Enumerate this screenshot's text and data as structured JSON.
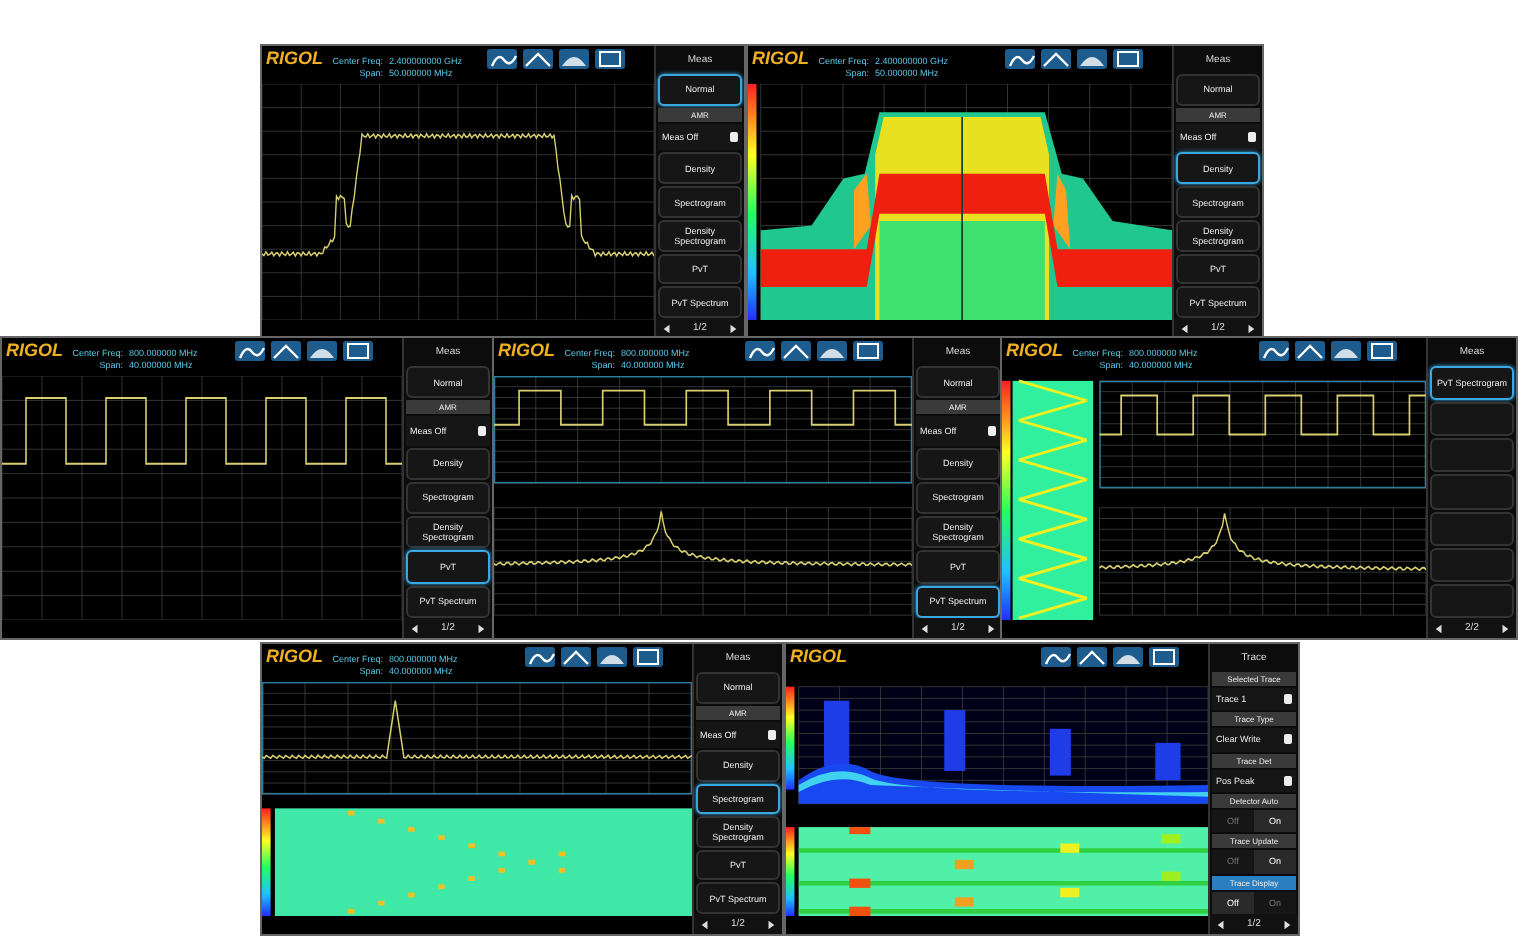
{
  "panels": [
    {
      "logo": "RIGOL",
      "readouts": [
        {
          "label": "Center Freq:",
          "value": "2.400000000 GHz"
        },
        {
          "label": "Span:",
          "value": "50.000000 MHz"
        }
      ],
      "plot": {
        "kind": "band"
      },
      "menu": {
        "title": "Meas",
        "page": "1/2",
        "items": [
          {
            "kind": "button",
            "label": "Normal",
            "selected": true
          },
          {
            "kind": "header",
            "label": "AMR"
          },
          {
            "kind": "select",
            "label": "Meas Off"
          },
          {
            "kind": "button",
            "label": "Density",
            "selected": false
          },
          {
            "kind": "button",
            "label": "Spectrogram",
            "selected": false
          },
          {
            "kind": "button",
            "label": "Density Spectrogram",
            "selected": false
          },
          {
            "kind": "button",
            "label": "PvT",
            "selected": false
          },
          {
            "kind": "button",
            "label": "PvT Spectrum",
            "selected": false
          }
        ]
      }
    },
    {
      "logo": "RIGOL",
      "readouts": [
        {
          "label": "Center Freq:",
          "value": "2.400000000 GHz"
        },
        {
          "label": "Span:",
          "value": "50.000000 MHz"
        }
      ],
      "plot": {
        "kind": "density"
      },
      "menu": {
        "title": "Meas",
        "page": "1/2",
        "items": [
          {
            "kind": "button",
            "label": "Normal",
            "selected": false
          },
          {
            "kind": "header",
            "label": "AMR"
          },
          {
            "kind": "select",
            "label": "Meas Off"
          },
          {
            "kind": "button",
            "label": "Density",
            "selected": true
          },
          {
            "kind": "button",
            "label": "Spectrogram",
            "selected": false
          },
          {
            "kind": "button",
            "label": "Density Spectrogram",
            "selected": false
          },
          {
            "kind": "button",
            "label": "PvT",
            "selected": false
          },
          {
            "kind": "button",
            "label": "PvT Spectrum",
            "selected": false
          }
        ]
      }
    },
    {
      "logo": "RIGOL",
      "readouts": [
        {
          "label": "Center Freq:",
          "value": "800.000000 MHz"
        },
        {
          "label": "Span:",
          "value": "40.000000 MHz"
        }
      ],
      "plot": {
        "kind": "square"
      },
      "menu": {
        "title": "Meas",
        "page": "1/2",
        "items": [
          {
            "kind": "button",
            "label": "Normal",
            "selected": false
          },
          {
            "kind": "header",
            "label": "AMR"
          },
          {
            "kind": "select",
            "label": "Meas Off"
          },
          {
            "kind": "button",
            "label": "Density",
            "selected": false
          },
          {
            "kind": "button",
            "label": "Spectrogram",
            "selected": false
          },
          {
            "kind": "button",
            "label": "Density Spectrogram",
            "selected": false
          },
          {
            "kind": "button",
            "label": "PvT",
            "selected": true
          },
          {
            "kind": "button",
            "label": "PvT Spectrum",
            "selected": false
          }
        ]
      }
    },
    {
      "logo": "RIGOL",
      "readouts": [
        {
          "label": "Center Freq:",
          "value": "800.000000 MHz"
        },
        {
          "label": "Span:",
          "value": "40.000000 MHz"
        }
      ],
      "plot": {
        "kind": "pvt"
      },
      "menu": {
        "title": "Meas",
        "page": "1/2",
        "items": [
          {
            "kind": "button",
            "label": "Normal",
            "selected": false
          },
          {
            "kind": "header",
            "label": "AMR"
          },
          {
            "kind": "select",
            "label": "Meas Off"
          },
          {
            "kind": "button",
            "label": "Density",
            "selected": false
          },
          {
            "kind": "button",
            "label": "Spectrogram",
            "selected": false
          },
          {
            "kind": "button",
            "label": "Density Spectrogram",
            "selected": false
          },
          {
            "kind": "button",
            "label": "PvT",
            "selected": false
          },
          {
            "kind": "button",
            "label": "PvT Spectrum",
            "selected": true
          }
        ]
      }
    },
    {
      "logo": "RIGOL",
      "readouts": [
        {
          "label": "Center Freq:",
          "value": "800.000000 MHz"
        },
        {
          "label": "Span:",
          "value": "40.000000 MHz"
        }
      ],
      "plot": {
        "kind": "pvt_spectrogram"
      },
      "menu": {
        "title": "Meas",
        "page": "2/2",
        "items": [
          {
            "kind": "button",
            "label": "PvT Spectrogram",
            "selected": true
          },
          {
            "kind": "blank"
          },
          {
            "kind": "blank"
          },
          {
            "kind": "blank"
          },
          {
            "kind": "blank"
          },
          {
            "kind": "blank"
          },
          {
            "kind": "blank"
          }
        ]
      }
    },
    {
      "logo": "RIGOL",
      "readouts": [
        {
          "label": "Center Freq:",
          "value": "800.000000 MHz"
        },
        {
          "label": "Span:",
          "value": "40.000000 MHz"
        }
      ],
      "plot": {
        "kind": "spectrogram"
      },
      "menu": {
        "title": "Meas",
        "page": "1/2",
        "items": [
          {
            "kind": "button",
            "label": "Normal",
            "selected": false
          },
          {
            "kind": "header",
            "label": "AMR"
          },
          {
            "kind": "select",
            "label": "Meas Off"
          },
          {
            "kind": "button",
            "label": "Density",
            "selected": false
          },
          {
            "kind": "button",
            "label": "Spectrogram",
            "selected": true
          },
          {
            "kind": "button",
            "label": "Density Spectrogram",
            "selected": false
          },
          {
            "kind": "button",
            "label": "PvT",
            "selected": false
          },
          {
            "kind": "button",
            "label": "PvT Spectrum",
            "selected": false
          }
        ]
      }
    },
    {
      "logo": "RIGOL",
      "plot": {
        "kind": "waterfall"
      },
      "menu": {
        "title": "Trace",
        "page": "1/2",
        "items": [
          {
            "kind": "header",
            "label": "Selected Trace"
          },
          {
            "kind": "select",
            "label": "Trace 1"
          },
          {
            "kind": "header",
            "label": "Trace Type"
          },
          {
            "kind": "select",
            "label": "Clear Write"
          },
          {
            "kind": "header",
            "label": "Trace Det"
          },
          {
            "kind": "select",
            "label": "Pos Peak"
          },
          {
            "kind": "header",
            "label": "Detector Auto"
          },
          {
            "kind": "switch",
            "options": [
              {
                "label": "Off",
                "selected": false
              },
              {
                "label": "On",
                "selected": true
              }
            ]
          },
          {
            "kind": "header",
            "label": "Trace Update"
          },
          {
            "kind": "switch",
            "options": [
              {
                "label": "Off",
                "selected": false
              },
              {
                "label": "On",
                "selected": true
              }
            ]
          },
          {
            "kind": "header",
            "label": "Trace Display",
            "selected": true
          },
          {
            "kind": "switch",
            "options": [
              {
                "label": "Off",
                "selected": true
              },
              {
                "label": "On",
                "selected": false
              }
            ]
          }
        ]
      }
    }
  ]
}
